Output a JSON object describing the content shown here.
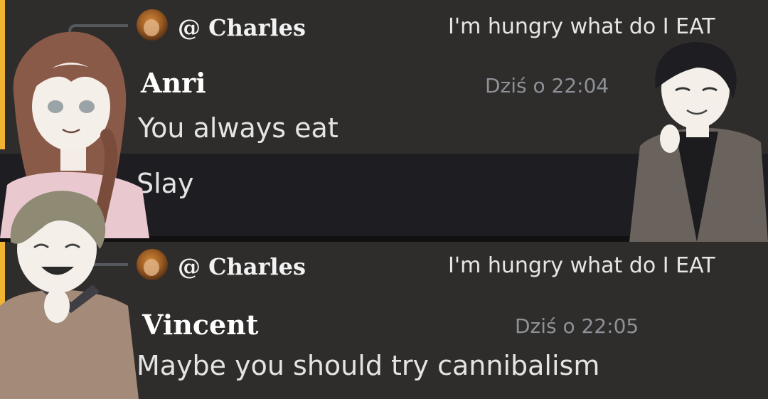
{
  "messages": [
    {
      "reply": {
        "author": "@ Charles",
        "text": "I'm hungry what do I EAT"
      },
      "author": "Anri",
      "timestamp": "Dziś o 22:04",
      "lines": [
        "You always eat",
        "Slay"
      ]
    },
    {
      "reply": {
        "author": "@ Charles",
        "text": "I'm hungry what do I EAT"
      },
      "author": "Vincent",
      "timestamp": "Dziś o 22:05",
      "lines": [
        "Maybe you should try cannibalism"
      ]
    }
  ],
  "colors": {
    "accent": "#f0b332",
    "background": "#2f2d2b",
    "highlight": "#1e1e22",
    "timestamp": "#8e9197"
  },
  "characters": [
    "anri-illustration",
    "vincent-illustration",
    "dark-haired-illustration"
  ]
}
